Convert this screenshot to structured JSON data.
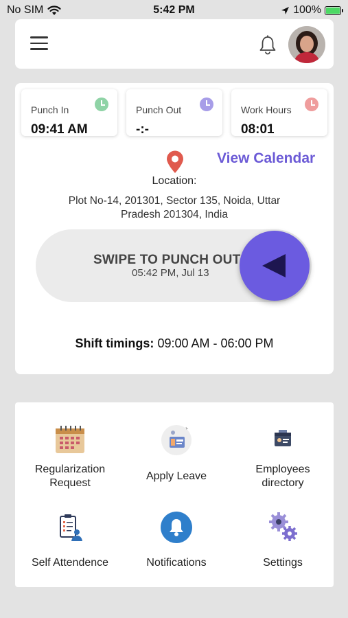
{
  "status_bar": {
    "carrier": "No SIM",
    "time": "5:42 PM",
    "battery": "100%"
  },
  "header": {
    "menu_icon": "hamburger-menu-icon",
    "bell_icon": "bell-icon",
    "avatar": "user-avatar"
  },
  "stats": [
    {
      "label": "Punch In",
      "value": "09:41 AM",
      "clock_color": "#8fd3a6"
    },
    {
      "label": "Punch Out",
      "value": "-:-",
      "clock_color": "#a79de8"
    },
    {
      "label": "Work Hours",
      "value": "08:01",
      "clock_color": "#ef9d9d"
    }
  ],
  "location": {
    "view_calendar": "View Calendar",
    "label": "Location:",
    "address_line1": "Plot No-14, 201301, Sector 135, Noida, Uttar",
    "address_line2": "Pradesh 201304, India"
  },
  "swipe": {
    "title": "SWIPE TO PUNCH OUT",
    "subtitle": "05:42 PM, Jul 13",
    "accent": "#6b5be0"
  },
  "shift": {
    "label": "Shift timings:",
    "value": "09:00 AM - 06:00 PM"
  },
  "tiles": [
    {
      "label_line1": "Regularization",
      "label_line2": "Request",
      "icon": "calendar-icon"
    },
    {
      "label_line1": "Apply Leave",
      "label_line2": "",
      "icon": "leave-icon"
    },
    {
      "label_line1": "Employees",
      "label_line2": "directory",
      "icon": "directory-icon"
    },
    {
      "label_line1": "Self Attendence",
      "label_line2": "",
      "icon": "clipboard-user-icon"
    },
    {
      "label_line1": "Notifications",
      "label_line2": "",
      "icon": "notification-bell-icon"
    },
    {
      "label_line1": "Settings",
      "label_line2": "",
      "icon": "gears-icon"
    }
  ]
}
